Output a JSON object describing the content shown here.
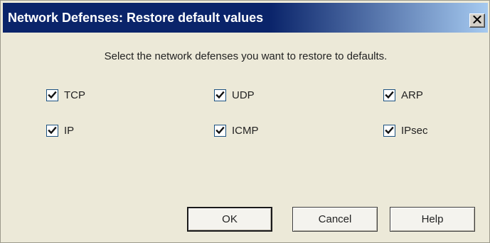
{
  "dialog": {
    "title": "Network Defenses: Restore default values",
    "close_icon": "close-icon",
    "instruction": "Select the network defenses you want to restore to defaults.",
    "checkboxes": [
      {
        "label": "TCP",
        "checked": true
      },
      {
        "label": "UDP",
        "checked": true
      },
      {
        "label": "ARP",
        "checked": true
      },
      {
        "label": "IP",
        "checked": true
      },
      {
        "label": "ICMP",
        "checked": true
      },
      {
        "label": "IPsec",
        "checked": true
      }
    ],
    "buttons": {
      "ok": "OK",
      "cancel": "Cancel",
      "help": "Help"
    }
  },
  "colors": {
    "title_bar_start": "#0a246a",
    "title_bar_end": "#a6caf0",
    "dialog_background": "#ece9d8"
  }
}
